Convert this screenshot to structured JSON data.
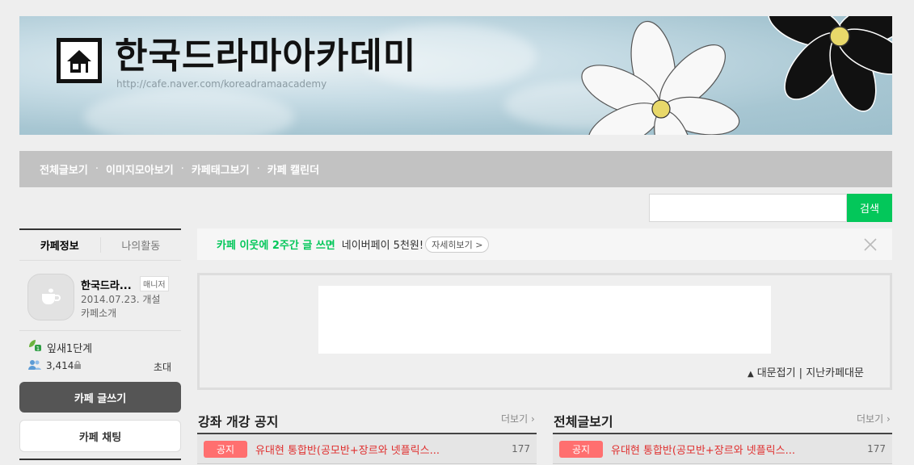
{
  "banner": {
    "title": "한국드라마아카데미",
    "url": "http://cafe.naver.com/koreadramaacademy"
  },
  "nav": {
    "items": [
      "전체글보기",
      "이미지모아보기",
      "카페태그보기",
      "카페 캘린더"
    ],
    "separator": "·"
  },
  "search": {
    "placeholder": "",
    "button_label": "검색"
  },
  "sidebar": {
    "tabs": [
      "카페정보",
      "나의활동"
    ],
    "cafe_name": "한국드라...",
    "manager_badge": "매니저",
    "created": "2014.07.23. 개설",
    "intro_link": "카페소개",
    "level": "잎새1단계",
    "member_count": "3,414",
    "invite": "초대",
    "write_button": "카페 글쓰기",
    "chat_button": "카페 채팅"
  },
  "promo": {
    "highlight": "카페 이웃에 2주간 글 쓰면",
    "text": "네이버페이 5천원!",
    "detail": "자세히보기 >"
  },
  "main_banner": {
    "fold_text": "대문접기 | 지난카페대문"
  },
  "boards": [
    {
      "title": "강좌 개강 공지",
      "more": "더보기",
      "rows": [
        {
          "badge": "공지",
          "title": "유대현 통합반(공모반+장르와 넷플릭스...",
          "count": "177"
        }
      ]
    },
    {
      "title": "전체글보기",
      "more": "더보기",
      "rows": [
        {
          "badge": "공지",
          "title": "유대현 통합반(공모반+장르와 넷플릭스...",
          "count": "177"
        }
      ]
    }
  ],
  "colors": {
    "accent_green": "#03c75a",
    "notice_badge": "#ff6f6f",
    "notice_title": "#e0302f",
    "nav_bg": "#c2c2c2"
  }
}
